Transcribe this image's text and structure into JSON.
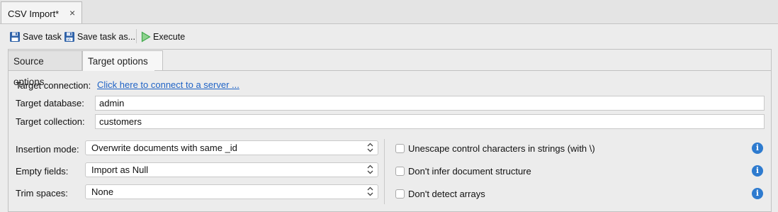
{
  "document_tab": {
    "title": "CSV Import*",
    "close_glyph": "×"
  },
  "toolbar": {
    "save_task": "Save task",
    "save_task_as": "Save task as...",
    "execute": "Execute"
  },
  "subtabs": [
    "Source options",
    "Target options"
  ],
  "target": {
    "connection_label": "Target connection:",
    "connection_link": "Click here to connect to a server ...",
    "database_label": "Target database:",
    "database_value": "admin",
    "collection_label": "Target collection:",
    "collection_value": "customers"
  },
  "options": {
    "insertion_mode_label": "Insertion mode:",
    "insertion_mode_value": "Overwrite documents with same _id",
    "empty_fields_label": "Empty fields:",
    "empty_fields_value": "Import as Null",
    "trim_spaces_label": "Trim spaces:",
    "trim_spaces_value": "None"
  },
  "checkboxes": [
    {
      "label": "Unescape control characters in strings (with \\)",
      "checked": false
    },
    {
      "label": "Don't infer document structure",
      "checked": false
    },
    {
      "label": "Don't detect arrays",
      "checked": false
    }
  ],
  "icons": {
    "save": "floppy-disk-icon",
    "save_as": "floppy-disk-ab-icon",
    "execute": "play-icon",
    "chevron": "updown-chevron-icon",
    "info": "info-icon",
    "info_glyph": "i"
  },
  "colors": {
    "link": "#1f63c6",
    "info": "#2e7bcf",
    "execute_green": "#3fa84a",
    "save_blue": "#2f62a8"
  }
}
